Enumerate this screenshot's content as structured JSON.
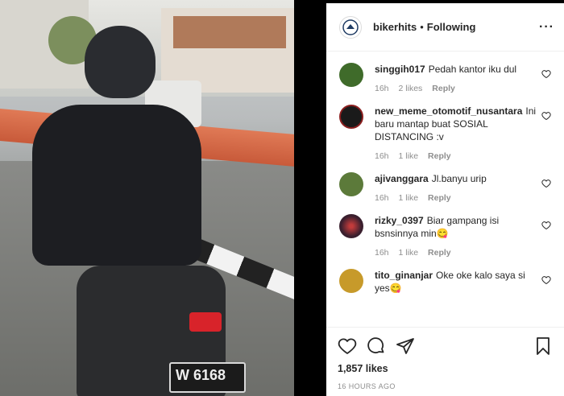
{
  "post": {
    "username": "bikerhits",
    "separator": "•",
    "follow_status": "Following",
    "more_label": "···"
  },
  "photo": {
    "plate_text": "W 6168"
  },
  "comments": [
    {
      "user": "singgih017",
      "text": "Pedah kantor iku dul",
      "time": "16h",
      "likes": "2 likes",
      "reply": "Reply",
      "avatar_color": "#3f6b2a"
    },
    {
      "user": "new_meme_otomotif_nusantara",
      "text": "Ini baru mantap buat SOSIAL DISTANCING :v",
      "time": "16h",
      "likes": "1 like",
      "reply": "Reply",
      "avatar_color": "#1a1a1a"
    },
    {
      "user": "ajivanggara",
      "text": "Jl.banyu urip",
      "time": "16h",
      "likes": "1 like",
      "reply": "Reply",
      "avatar_color": "#5c7a3a"
    },
    {
      "user": "rizky_0397",
      "text": "Biar gampang isi bsnsinnya min😋",
      "time": "16h",
      "likes": "1 like",
      "reply": "Reply",
      "avatar_color": "#3a1f2e"
    },
    {
      "user": "tito_ginanjar",
      "text": "Oke oke kalo saya si yes😋",
      "time": "",
      "likes": "",
      "reply": "",
      "avatar_color": "#c79a2a"
    }
  ],
  "stats": {
    "likes": "1,857 likes",
    "time_ago": "16 HOURS AGO"
  },
  "icons": {
    "like": "heart-icon",
    "comment": "comment-icon",
    "share": "share-icon",
    "save": "bookmark-icon",
    "more": "more-icon"
  }
}
